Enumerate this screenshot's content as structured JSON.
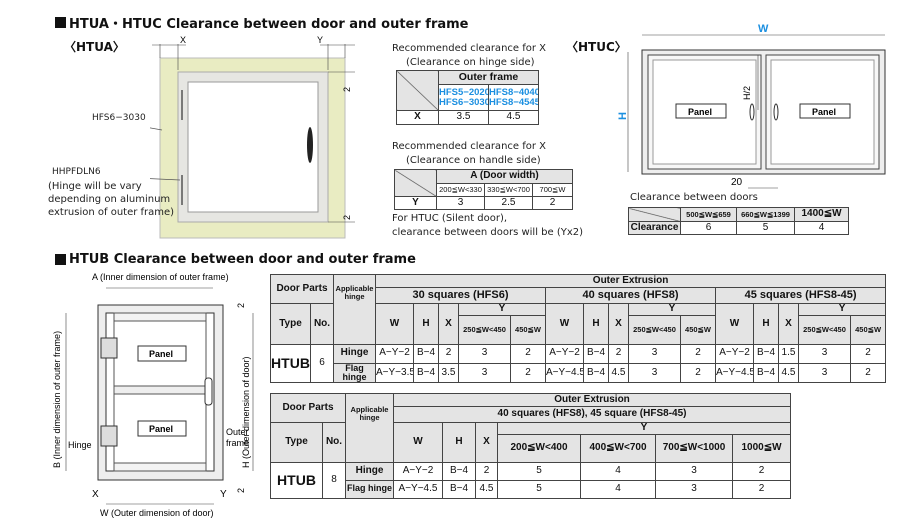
{
  "section1": {
    "title": "HTUA・HTUC Clearance between door and outer frame"
  },
  "htua": {
    "label": "〈HTUA〉",
    "x": "X",
    "y": "Y",
    "two_top": "2",
    "two_bottom": "2",
    "frame_label": "HFS6−3030",
    "hinge_label": "HHPFDLN6",
    "hinge_note": [
      "(Hinge will be vary",
      "depending on aluminum",
      "extrusion of outer frame)"
    ]
  },
  "table_hinge": {
    "caption": [
      "Recommended clearance for X",
      "(Clearance on hinge side)"
    ],
    "header": "Outer frame",
    "col1": [
      "HFS5−2020",
      "HFS6−3030"
    ],
    "col2": [
      "HFS8−4040",
      "HFS8−4545"
    ],
    "row_label": "X",
    "values": [
      "3.5",
      "4.5"
    ]
  },
  "table_handle": {
    "caption": [
      "Recommended clearance for X",
      "(Clearance on handle side)"
    ],
    "header": "A (Door width)",
    "ranges": [
      "200≦W<330",
      "330≦W<700",
      "700≦W"
    ],
    "row_label": "Y",
    "values": [
      "3",
      "2.5",
      "2"
    ],
    "note": [
      "For HTUC (Silent door),",
      "clearance between doors will be (Yx2)"
    ]
  },
  "htuc": {
    "label": "〈HTUC〉",
    "w": "W",
    "h": "H",
    "h2": "H/2",
    "gap": "20",
    "panel": "Panel"
  },
  "table_doors": {
    "caption": "Clearance between doors",
    "ranges": [
      "500≦W≦659",
      "660≦W≦1399",
      "1400≦W"
    ],
    "row_label": "Clearance",
    "values": [
      "6",
      "5",
      "4"
    ]
  },
  "section2": {
    "title": "HTUB Clearance between door and outer frame"
  },
  "htub": {
    "a": "A (Inner dimension of outer frame)",
    "b": "B (Inner dimension of outer frame)",
    "h": "H (Outer dimension of door)",
    "w": "W (Outer dimension of door)",
    "x": "X",
    "y": "Y",
    "two": "2",
    "panel": "Panel",
    "hinge": "Hinge",
    "outer_frame": [
      "Outer",
      "frame"
    ]
  },
  "table6": {
    "door_parts": "Door Parts",
    "applicable": [
      "Applicable",
      "hinge"
    ],
    "outer": "Outer Extrusion",
    "type": "Type",
    "no": "No.",
    "groups": [
      "30 squares (HFS6)",
      "40 squares (HFS8)",
      "45 squares (HFS8-45)"
    ],
    "w": "W",
    "h": "H",
    "x": "X",
    "y": "Y",
    "ranges": [
      "250≦W<450",
      "450≦W"
    ],
    "type_val": "HTUB",
    "no_val": "6",
    "rows": [
      {
        "hinge": "Hinge",
        "vals": [
          "A−Y−2",
          "B−4",
          "2",
          "3",
          "2",
          "A−Y−2",
          "B−4",
          "2",
          "3",
          "2",
          "A−Y−2",
          "B−4",
          "1.5",
          "3",
          "2"
        ]
      },
      {
        "hinge": "Flag hinge",
        "vals": [
          "A−Y−3.5",
          "B−4",
          "3.5",
          "3",
          "2",
          "A−Y−4.5",
          "B−4",
          "4.5",
          "3",
          "2",
          "A−Y−4.5",
          "B−4",
          "4.5",
          "3",
          "2"
        ]
      }
    ]
  },
  "table8": {
    "door_parts": "Door Parts",
    "applicable": [
      "Applicable",
      "hinge"
    ],
    "outer": "Outer Extrusion",
    "group": "40 squares (HFS8), 45 square (HFS8-45)",
    "type": "Type",
    "no": "No.",
    "w": "W",
    "h": "H",
    "x": "X",
    "y": "Y",
    "ranges": [
      "200≦W<400",
      "400≦W<700",
      "700≦W<1000",
      "1000≦W"
    ],
    "type_val": "HTUB",
    "no_val": "8",
    "rows": [
      {
        "hinge": "Hinge",
        "vals": [
          "A−Y−2",
          "B−4",
          "2",
          "5",
          "4",
          "3",
          "2"
        ]
      },
      {
        "hinge": "Flag hinge",
        "vals": [
          "A−Y−4.5",
          "B−4",
          "4.5",
          "5",
          "4",
          "3",
          "2"
        ]
      }
    ]
  },
  "colors": {
    "frame": "#e9ecc2",
    "door": "#e6e6e2",
    "header": "#e4e4e4",
    "blue": "#1b8fe0"
  }
}
